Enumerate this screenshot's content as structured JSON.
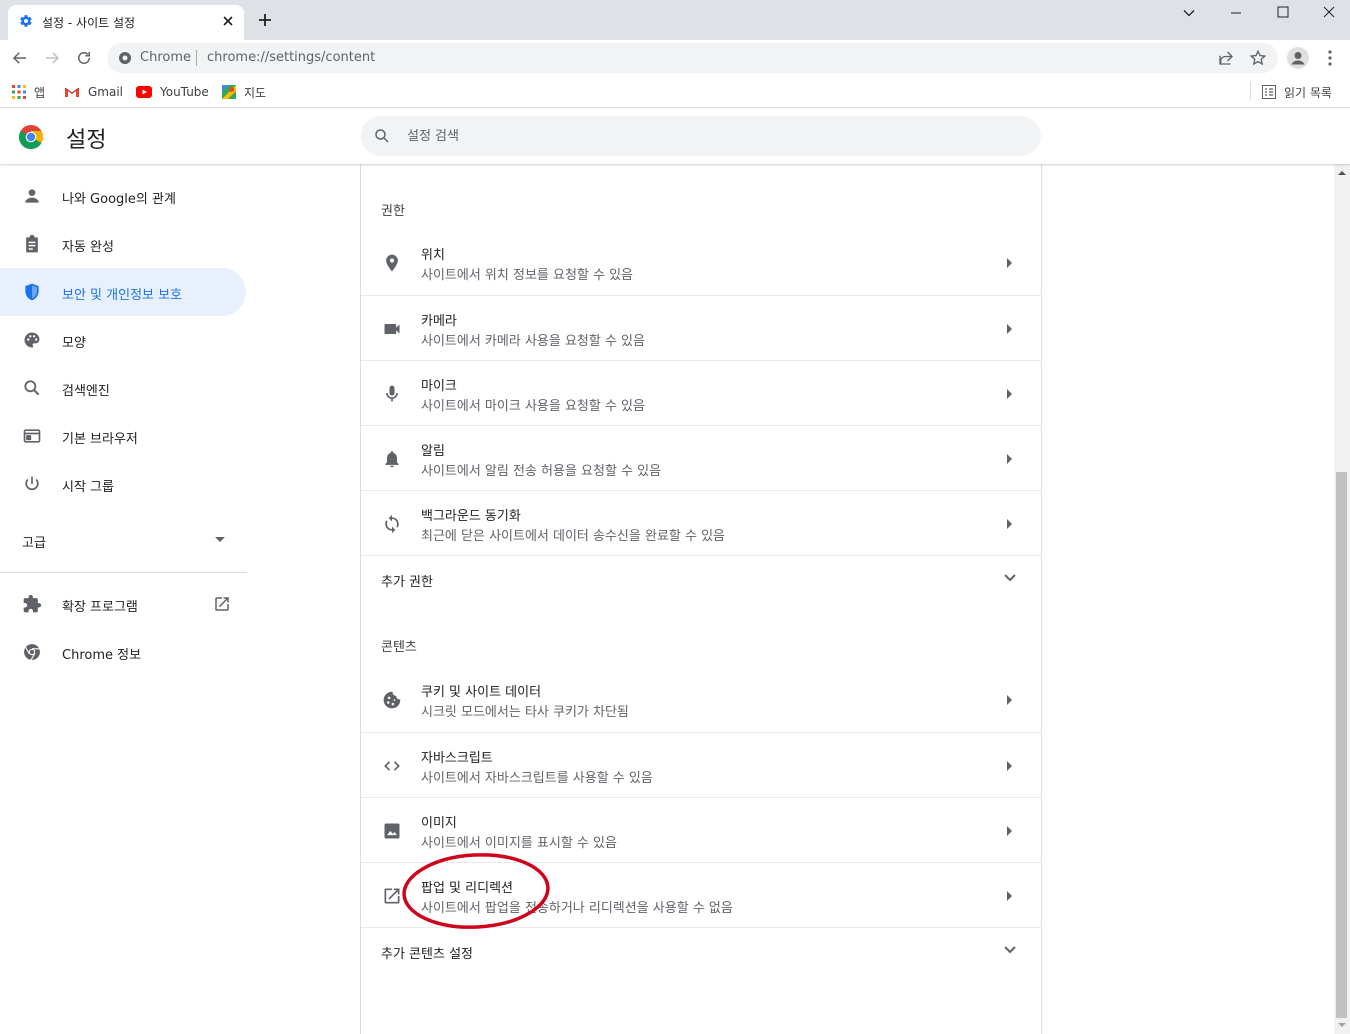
{
  "browser": {
    "tab_title": "설정 - 사이트 설정",
    "omnibox_origin": "Chrome",
    "url": "chrome://settings/content",
    "bookmarks": [
      {
        "label": "앱",
        "icon": "apps-grid-icon"
      },
      {
        "label": "Gmail",
        "icon": "gmail-icon"
      },
      {
        "label": "YouTube",
        "icon": "youtube-icon"
      },
      {
        "label": "지도",
        "icon": "maps-icon"
      }
    ],
    "reading_list": "읽기 목록"
  },
  "header": {
    "title": "설정",
    "search_placeholder": "설정 검색"
  },
  "sidebar": {
    "items": [
      {
        "label": "나와 Google의 관계",
        "icon": "person-icon"
      },
      {
        "label": "자동 완성",
        "icon": "clipboard-icon"
      },
      {
        "label": "보안 및 개인정보 보호",
        "icon": "shield-icon",
        "active": true
      },
      {
        "label": "모양",
        "icon": "palette-icon"
      },
      {
        "label": "검색엔진",
        "icon": "search-icon"
      },
      {
        "label": "기본 브라우저",
        "icon": "browser-window-icon"
      },
      {
        "label": "시작 그룹",
        "icon": "power-icon"
      }
    ],
    "advanced": "고급",
    "extensions": "확장 프로그램",
    "about": "Chrome 정보"
  },
  "permissions": {
    "section_title": "권한",
    "rows": [
      {
        "title": "위치",
        "subtitle": "사이트에서 위치 정보를 요청할 수 있음",
        "icon": "location-pin-icon"
      },
      {
        "title": "카메라",
        "subtitle": "사이트에서 카메라 사용을 요청할 수 있음",
        "icon": "camera-icon"
      },
      {
        "title": "마이크",
        "subtitle": "사이트에서 마이크 사용을 요청할 수 있음",
        "icon": "microphone-icon"
      },
      {
        "title": "알림",
        "subtitle": "사이트에서 알림 전송 허용을 요청할 수 있음",
        "icon": "bell-icon"
      },
      {
        "title": "백그라운드 동기화",
        "subtitle": "최근에 닫은 사이트에서 데이터 송수신을 완료할 수 있음",
        "icon": "sync-icon"
      }
    ],
    "more_label": "추가 권한"
  },
  "content": {
    "section_title": "콘텐츠",
    "rows": [
      {
        "title": "쿠키 및 사이트 데이터",
        "subtitle": "시크릿 모드에서는 타사 쿠키가 차단됨",
        "icon": "cookie-icon"
      },
      {
        "title": "자바스크립트",
        "subtitle": "사이트에서 자바스크립트를 사용할 수 있음",
        "icon": "code-icon"
      },
      {
        "title": "이미지",
        "subtitle": "사이트에서 이미지를 표시할 수 있음",
        "icon": "image-icon"
      },
      {
        "title": "팝업 및 리디렉션",
        "subtitle": "사이트에서 팝업을 전송하거나 리디렉션을 사용할 수 없음",
        "icon": "open-in-new-icon"
      }
    ],
    "more_label": "추가 콘텐츠 설정"
  },
  "colors": {
    "accent": "#1a73e8",
    "active_nav_bg": "#e8f0fe",
    "annotation": "#d0021b",
    "icon": "#5f6368"
  }
}
